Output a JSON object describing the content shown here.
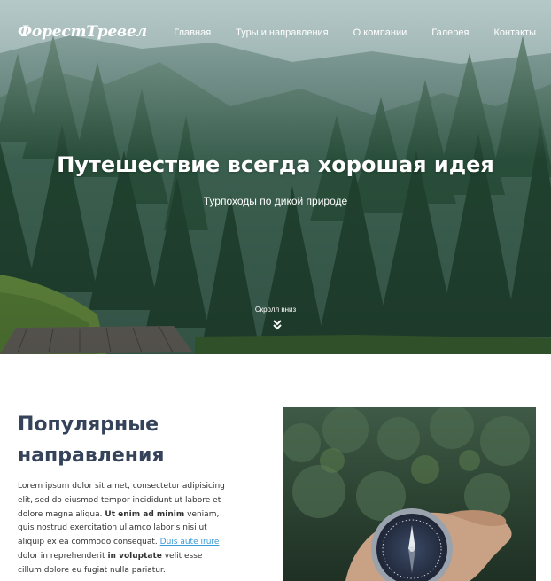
{
  "header": {
    "logo": "ФорестТревел",
    "nav": [
      "Главная",
      "Туры и направления",
      "О компании",
      "Галерея",
      "Контакты"
    ]
  },
  "hero": {
    "title": "Путешествие всегда хорошая идея",
    "subtitle": "Турпоходы по дикой природе",
    "scroll_label": "Скролл вниз"
  },
  "section": {
    "title": "Популярные направления",
    "paragraph": {
      "part1": "Lorem ipsum dolor sit amet, consectetur adipisicing elit, sed do eiusmod tempor incididunt ut labore et dolore magna aliqua.",
      "bold1": "Ut enim ad minim",
      "part2": "veniam, quis nostrud exercitation ullamco laboris nisi ut aliquip ex ea commodo consequat.",
      "link": "Duis aute irure",
      "part3": "dolor in reprehenderit",
      "bold2": "in voluptate",
      "part4": "velit esse cillum dolore eu fugiat nulla pariatur."
    }
  },
  "colors": {
    "heading": "#34425a",
    "link": "#3b9bd8",
    "hero_overlay": "#4f7a6c"
  }
}
